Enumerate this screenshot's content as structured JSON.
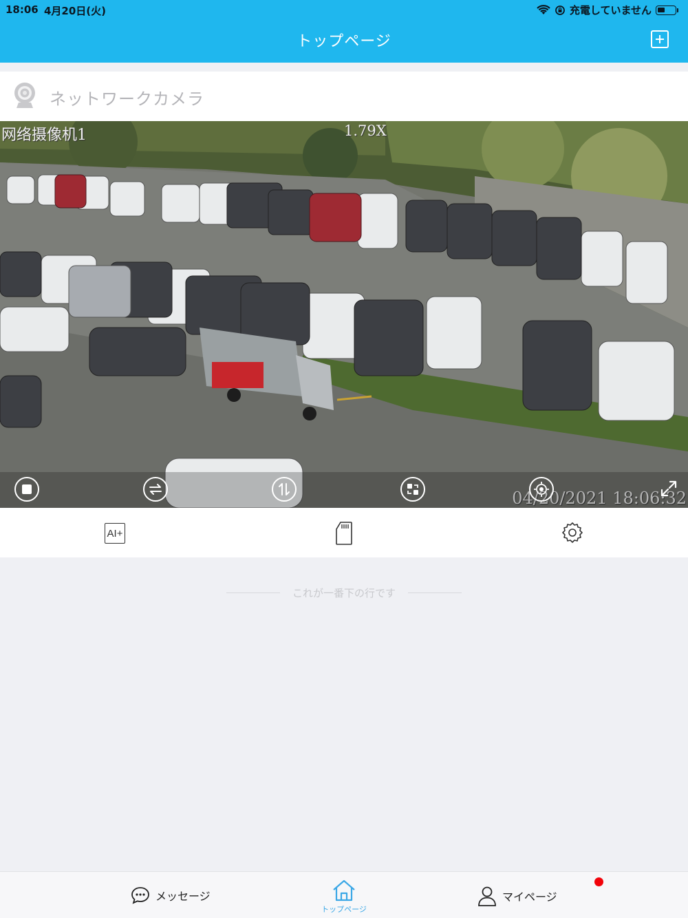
{
  "status_bar": {
    "time": "18:06",
    "date": "4月20日(火)",
    "charging": "充電していません"
  },
  "nav": {
    "title": "トップページ",
    "add_icon": "plus-square-icon"
  },
  "camera": {
    "name": "ネットワークカメラ",
    "osd_name": "网络摄像机1",
    "osd_zoom": "1.79X",
    "osd_timestamp": "04/20/2021  18:06:32",
    "controls": [
      "stop-icon",
      "swap-horizontal-icon",
      "swap-vertical-icon",
      "switch-view-icon",
      "ptz-target-icon",
      "fullscreen-icon"
    ]
  },
  "toolbar": {
    "ai_label": "AI+",
    "sd_icon": "sd-card-icon",
    "settings_icon": "gear-icon"
  },
  "list_end": {
    "text": "これが一番下の行です"
  },
  "tabbar": {
    "messages": "メッセージ",
    "home": "トップページ",
    "mypage": "マイページ"
  },
  "colors": {
    "primary": "#1fb7ee",
    "background": "#eff0f4",
    "badge": "#f2030a",
    "active_tab": "#3aa7e6"
  }
}
